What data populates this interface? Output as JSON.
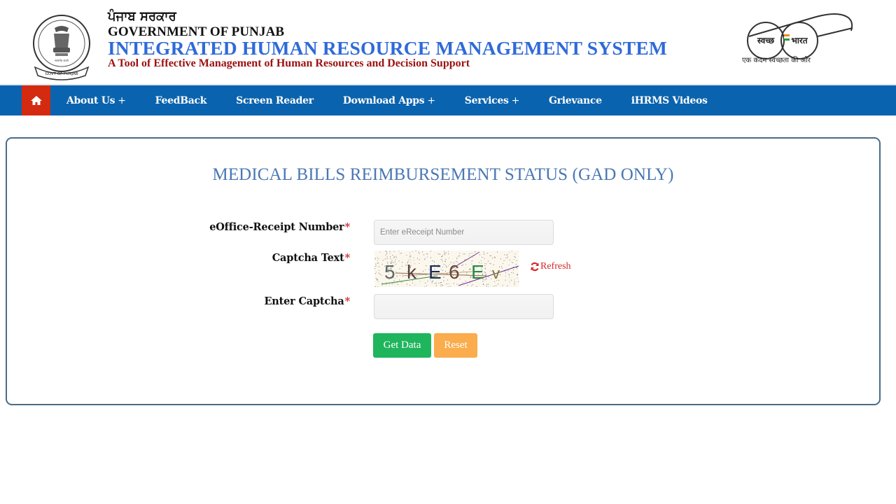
{
  "header": {
    "punjabi_title": "ਪੰਜਾਬ ਸਰਕਾਰ",
    "government": "GOVERNMENT OF PUNJAB",
    "system_title": "INTEGRATED HUMAN RESOURCE MANAGEMENT SYSTEM",
    "tagline": "A Tool of Effective Management of Human Resources and Decision Support",
    "emblem_text": "GOVT OF PUNJAB",
    "swachh": {
      "left_lens": "स्वच्छ",
      "right_lens": "भारत",
      "caption": "एक कदम स्वच्छता की ओर"
    }
  },
  "nav": {
    "home_icon": "home-icon",
    "items": [
      {
        "label": "About Us",
        "has_submenu": true,
        "suffix": "+"
      },
      {
        "label": "FeedBack",
        "has_submenu": false,
        "suffix": ""
      },
      {
        "label": "Screen Reader",
        "has_submenu": false,
        "suffix": ""
      },
      {
        "label": "Download Apps",
        "has_submenu": true,
        "suffix": "+"
      },
      {
        "label": "Services",
        "has_submenu": true,
        "suffix": "+"
      },
      {
        "label": "Grievance",
        "has_submenu": false,
        "suffix": ""
      },
      {
        "label": "iHRMS Videos",
        "has_submenu": false,
        "suffix": ""
      }
    ]
  },
  "form": {
    "title": "MEDICAL BILLS REIMBURSEMENT STATUS (GAD ONLY)",
    "receipt_label": "eOffice-Receipt Number",
    "receipt_placeholder": "Enter eReceipt Number",
    "receipt_value": "",
    "captcha_label": "Captcha Text",
    "captcha_chars": [
      "5",
      "k",
      "E",
      "6",
      "E",
      "v"
    ],
    "refresh_label": "Refresh",
    "enter_captcha_label": "Enter Captcha",
    "enter_captcha_value": "",
    "required_mark": "*",
    "get_data_label": "Get Data",
    "reset_label": "Reset"
  },
  "colors": {
    "nav_bg": "#0a63ae",
    "home_bg": "#d42a0f",
    "title_blue": "#4a77b4",
    "brand_blue": "#2f6ad8",
    "tagline_red": "#9b1111",
    "required_red": "#d42a2a",
    "get_data_green": "#1fb55d",
    "reset_orange": "#fbac4c"
  }
}
